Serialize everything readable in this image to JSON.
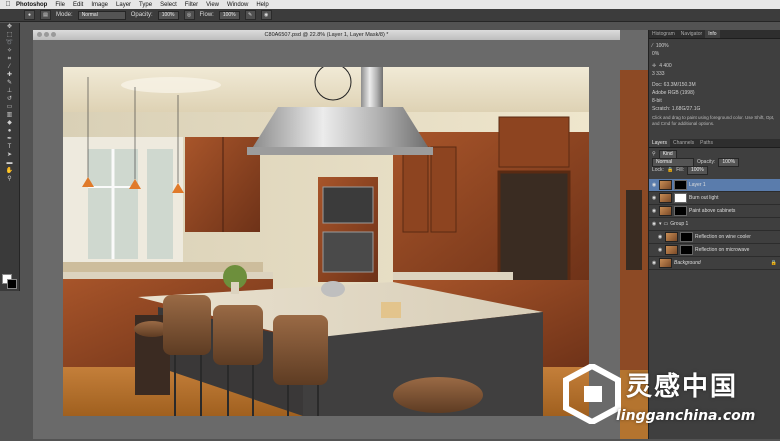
{
  "menubar": {
    "app_name": "Photoshop",
    "items": [
      "File",
      "Edit",
      "Image",
      "Layer",
      "Type",
      "Select",
      "Filter",
      "View",
      "Window",
      "Help"
    ]
  },
  "options_bar": {
    "mode_label": "Mode:",
    "mode_value": "Normal",
    "opacity_label": "Opacity:",
    "opacity_value": "100%",
    "flow_label": "Flow:",
    "flow_value": "100%"
  },
  "document": {
    "title": "C80A6507.psd @ 22.8% (Layer 1, Layer Mask/8) *"
  },
  "info_panel": {
    "tabs": [
      "Histogram",
      "Navigator",
      "Info"
    ],
    "values": [
      "100%",
      "0%",
      "4 400",
      "3 333"
    ],
    "doc_info": "Doc: 63.3M/150.3M",
    "profile": "Adobe RGB (1998)",
    "bits": "8-bit",
    "scratch": "Scratch: 1.68G/27.1G",
    "hint": "Click and drag to paint using foreground color. Use Shift, Opt, and Cmd for additional options."
  },
  "layers_panel": {
    "tabs": [
      "Layers",
      "Channels",
      "Paths"
    ],
    "kind_label": "Kind",
    "blend_mode": "Normal",
    "opacity_label": "Opacity:",
    "opacity_value": "100%",
    "lock_label": "Lock:",
    "fill_label": "Fill:",
    "fill_value": "100%",
    "layers": [
      {
        "name": "Layer 1",
        "selected": true,
        "mask": "black",
        "indent": 0
      },
      {
        "name": "Burn out light",
        "selected": false,
        "mask": "white",
        "indent": 0
      },
      {
        "name": "Paint above cabinets",
        "selected": false,
        "mask": "black",
        "indent": 0
      },
      {
        "name": "Group 1",
        "selected": false,
        "mask": "none",
        "indent": 0
      },
      {
        "name": "Reflection on wine cooler",
        "selected": false,
        "mask": "black",
        "indent": 1
      },
      {
        "name": "Reflection on microwave",
        "selected": false,
        "mask": "black",
        "indent": 1
      },
      {
        "name": "Background",
        "selected": false,
        "mask": "none",
        "indent": 0
      }
    ]
  },
  "watermark": {
    "cn": "灵感中国",
    "en": "lingganchina.com"
  }
}
